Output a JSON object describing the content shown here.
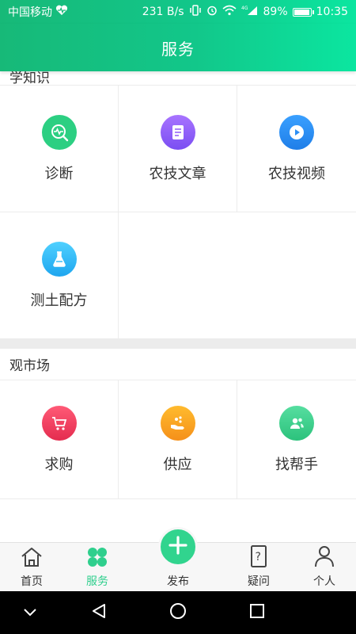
{
  "status_bar": {
    "carrier": "中国移动",
    "speed": "231 B/s",
    "signal_type": "4G",
    "battery": "89%",
    "battery_level": 0.89,
    "time": "10:35"
  },
  "header": {
    "title": "服务"
  },
  "sections": [
    {
      "title": "学知识",
      "items": [
        {
          "label": "诊断",
          "icon": "diagnosis-icon",
          "color": "#2ccf82"
        },
        {
          "label": "农技文章",
          "icon": "article-icon",
          "color": "#8f5cf7"
        },
        {
          "label": "农技视频",
          "icon": "video-play-icon",
          "color": "#2c8ff5"
        },
        {
          "label": "测土配方",
          "icon": "flask-icon",
          "color": "#2bb8f4"
        }
      ]
    },
    {
      "title": "观市场",
      "items": [
        {
          "label": "求购",
          "icon": "cart-icon",
          "color": "#f03f5f"
        },
        {
          "label": "供应",
          "icon": "supply-hand-icon",
          "color": "#f7a21c"
        },
        {
          "label": "找帮手",
          "icon": "helpers-icon",
          "color": "#35d08a"
        }
      ]
    }
  ],
  "bottom_nav": {
    "home": "首页",
    "service": "服务",
    "publish": "发布",
    "question": "疑问",
    "profile": "个人"
  },
  "colors": {
    "accent": "#31d48e",
    "header_start": "#17b978",
    "header_end": "#0be6a0"
  }
}
